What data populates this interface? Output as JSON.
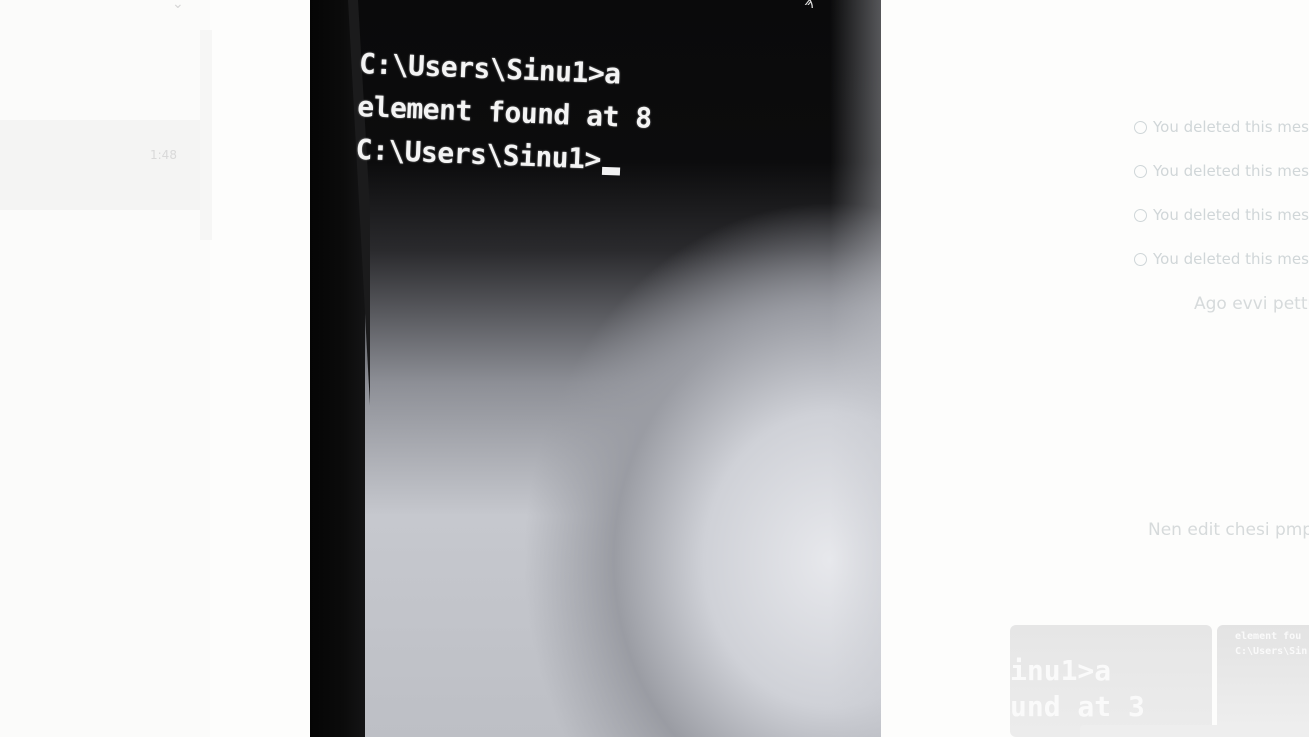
{
  "viewer": {
    "photo": {
      "terminal_lines": [
        "C:\\Users\\Sinu1>a",
        "element found at 8",
        "C:\\Users\\Sinu1>"
      ]
    }
  },
  "background": {
    "left_panel": {
      "timestamp": "1:48"
    },
    "system_messages": [
      "You deleted this mes",
      "You deleted this mes",
      "You deleted this mes",
      "You deleted this mes"
    ],
    "chat_text_1": "Ago evvi pettu",
    "chat_text_2": "Nen edit chesi pmpu",
    "thumbnails": [
      {
        "text": "inu1>a\nund at 3"
      },
      {
        "text": "element fou\nC:\\Users\\Sin"
      }
    ]
  },
  "icons": {
    "close": "chevron-icon",
    "deleted": "deleted-message-icon"
  }
}
